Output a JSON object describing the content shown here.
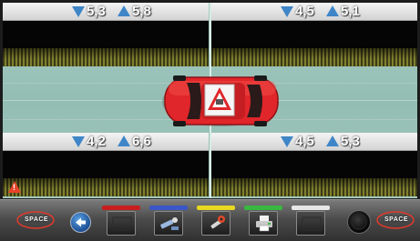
{
  "quadrants": [
    {
      "id": "front-left",
      "min_value": "5,3",
      "max_value": "5,8"
    },
    {
      "id": "front-right",
      "min_value": "4,5",
      "max_value": "5,1"
    },
    {
      "id": "rear-left",
      "min_value": "4,2",
      "max_value": "6,6"
    },
    {
      "id": "rear-right",
      "min_value": "4,5",
      "max_value": "5,3"
    }
  ],
  "logos": {
    "left": "SPACE",
    "right": "SPACE"
  },
  "colors": {
    "indicator": "#3e86c8",
    "car": "#e0262a",
    "warning": "#e8432a",
    "function_bars": [
      "#c81e1e",
      "#3a56c8",
      "#e8d820",
      "#38b840",
      "#e6e6e6"
    ]
  },
  "icons": {
    "back": "arrow-left-icon",
    "fn1": "blank-icon",
    "fn2": "measure-tool-icon",
    "fn3": "wrench-icon",
    "fn4": "printer-icon",
    "fn5": "blank-icon",
    "right": "circle-icon"
  }
}
